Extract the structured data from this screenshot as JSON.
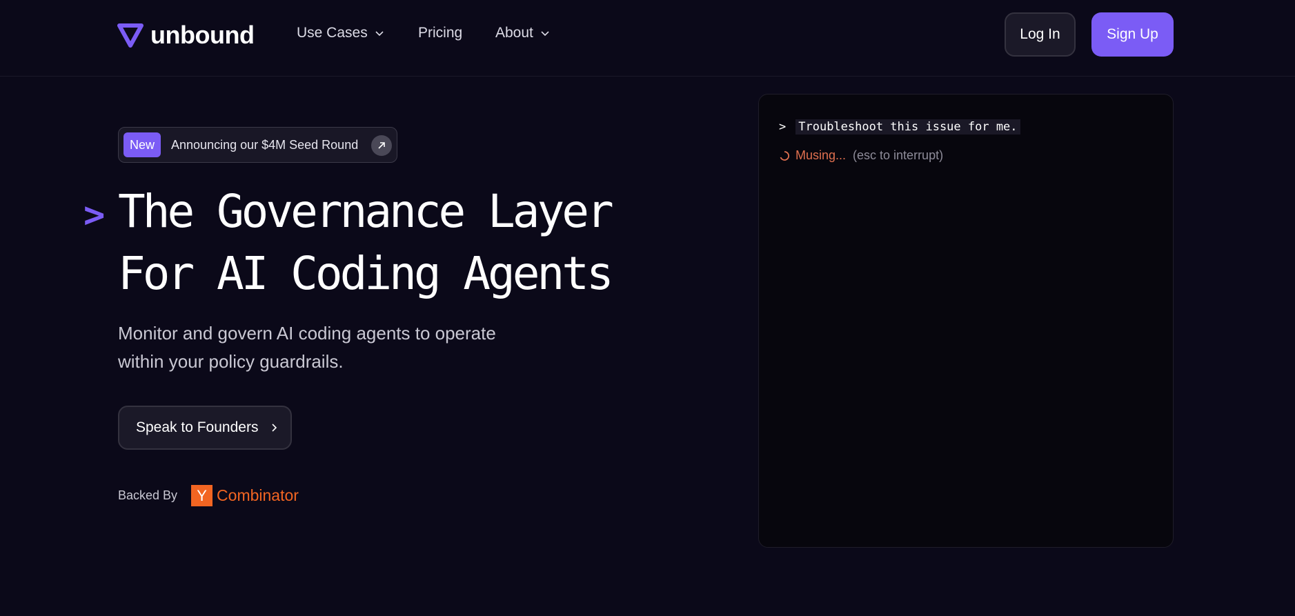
{
  "brand": {
    "name": "unbound",
    "accent": "#7b5cf5"
  },
  "nav": {
    "links": [
      {
        "label": "Use Cases",
        "has_dropdown": true
      },
      {
        "label": "Pricing",
        "has_dropdown": false
      },
      {
        "label": "About",
        "has_dropdown": true
      }
    ],
    "login_label": "Log In",
    "signup_label": "Sign Up"
  },
  "hero": {
    "badge_tag": "New",
    "badge_text": "Announcing our $4M Seed Round",
    "headline_caret": ">",
    "headline_line1": "The Governance Layer",
    "headline_line2": "For AI Coding Agents",
    "subhead": "Monitor and govern AI coding agents to operate within your policy guardrails.",
    "cta_label": "Speak to Founders",
    "backed_by_label": "Backed By",
    "yc_letter": "Y",
    "yc_name": "Combinator"
  },
  "terminal": {
    "prompt": ">",
    "command": "Troubleshoot this issue for me.",
    "status": "Musing...",
    "hint": "(esc to interrupt)"
  },
  "colors": {
    "background": "#0b0919",
    "button_dark": "#1b1928",
    "status_orange": "#e0704f",
    "yc_orange": "#f26522"
  }
}
